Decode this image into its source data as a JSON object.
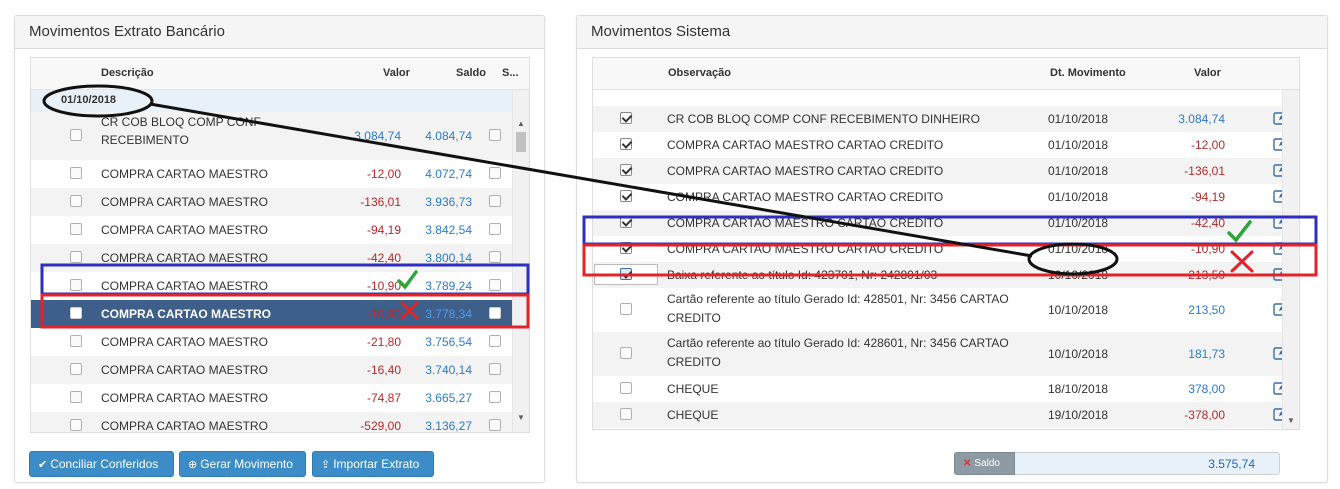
{
  "left_panel": {
    "title": "Movimentos Extrato Bancário",
    "headers": {
      "descricao": "Descrição",
      "valor": "Valor",
      "saldo": "Saldo",
      "s": "S..."
    },
    "group_date": "01/10/2018",
    "rows": [
      {
        "desc1": "CR COB BLOQ COMP CONF",
        "desc2": "RECEBIMENTO",
        "valor": "3.084,74",
        "saldo": "4.084,74"
      },
      {
        "desc1": "COMPRA CARTAO MAESTRO",
        "desc2": "",
        "valor": "-12,00",
        "saldo": "4.072,74"
      },
      {
        "desc1": "COMPRA CARTAO MAESTRO",
        "desc2": "",
        "valor": "-136,01",
        "saldo": "3.936,73"
      },
      {
        "desc1": "COMPRA CARTAO MAESTRO",
        "desc2": "",
        "valor": "-94,19",
        "saldo": "3.842,54"
      },
      {
        "desc1": "COMPRA CARTAO MAESTRO",
        "desc2": "",
        "valor": "-42,40",
        "saldo": "3.800,14"
      },
      {
        "desc1": "COMPRA CARTAO MAESTRO",
        "desc2": "",
        "valor": "-10,90",
        "saldo": "3.789,24"
      },
      {
        "desc1": "COMPRA CARTAO MAESTRO",
        "desc2": "",
        "valor": "-10,90",
        "saldo": "3.778,34"
      },
      {
        "desc1": "COMPRA CARTAO MAESTRO",
        "desc2": "",
        "valor": "-21,80",
        "saldo": "3.756,54"
      },
      {
        "desc1": "COMPRA CARTAO MAESTRO",
        "desc2": "",
        "valor": "-16,40",
        "saldo": "3.740,14"
      },
      {
        "desc1": "COMPRA CARTAO MAESTRO",
        "desc2": "",
        "valor": "-74,87",
        "saldo": "3.665,27"
      },
      {
        "desc1": "COMPRA CARTAO MAESTRO",
        "desc2": "",
        "valor": "-529,00",
        "saldo": "3.136,27"
      }
    ],
    "buttons": {
      "conciliar": "Conciliar Conferidos",
      "gerar": "Gerar Movimento",
      "importar": "Importar Extrato"
    }
  },
  "right_panel": {
    "title": "Movimentos Sistema",
    "headers": {
      "observacao": "Observação",
      "dt": "Dt. Movimento",
      "valor": "Valor"
    },
    "rows": [
      {
        "obs1": "CR COB BLOQ COMP CONF RECEBIMENTO DINHEIRO",
        "obs2": "",
        "dt": "01/10/2018",
        "valor": "3.084,74"
      },
      {
        "obs1": "COMPRA CARTAO MAESTRO CARTAO CREDITO",
        "obs2": "",
        "dt": "01/10/2018",
        "valor": "-12,00"
      },
      {
        "obs1": "COMPRA CARTAO MAESTRO CARTAO CREDITO",
        "obs2": "",
        "dt": "01/10/2018",
        "valor": "-136,01"
      },
      {
        "obs1": "COMPRA CARTAO MAESTRO CARTAO CREDITO",
        "obs2": "",
        "dt": "01/10/2018",
        "valor": "-94,19"
      },
      {
        "obs1": "COMPRA CARTAO MAESTRO CARTAO CREDITO",
        "obs2": "",
        "dt": "01/10/2018",
        "valor": "-42,40"
      },
      {
        "obs1": "COMPRA CARTAO MAESTRO CARTAO CREDITO",
        "obs2": "",
        "dt": "01/10/2018",
        "valor": "-10,90"
      },
      {
        "obs1": "Baixa referente ao título Id: 423701, Nr: 242801/03",
        "obs2": "",
        "dt": "10/10/2018",
        "valor": "-213,50"
      },
      {
        "obs1": "Cartão referente ao título Gerado Id: 428501, Nr: 3456 CARTAO",
        "obs2": "CREDITO",
        "dt": "10/10/2018",
        "valor": "213,50"
      },
      {
        "obs1": "Cartão referente ao título Gerado Id: 428601, Nr: 3456 CARTAO",
        "obs2": "CREDITO",
        "dt": "10/10/2018",
        "valor": "181,73"
      },
      {
        "obs1": "CHEQUE",
        "obs2": "",
        "dt": "18/10/2018",
        "valor": "378,00"
      },
      {
        "obs1": "CHEQUE",
        "obs2": "",
        "dt": "19/10/2018",
        "valor": "-378,00"
      }
    ],
    "saldo_label": "Saldo",
    "saldo_value": "3.575,74"
  },
  "colors": {
    "negative": "#b52a2a",
    "positive": "#2a7bd2",
    "selected_row": "#3e5f8a",
    "button": "#3b8cc7",
    "annotation_blue": "#2f2fbf",
    "annotation_red": "#e2232a",
    "annotation_green": "#2ea43a"
  }
}
